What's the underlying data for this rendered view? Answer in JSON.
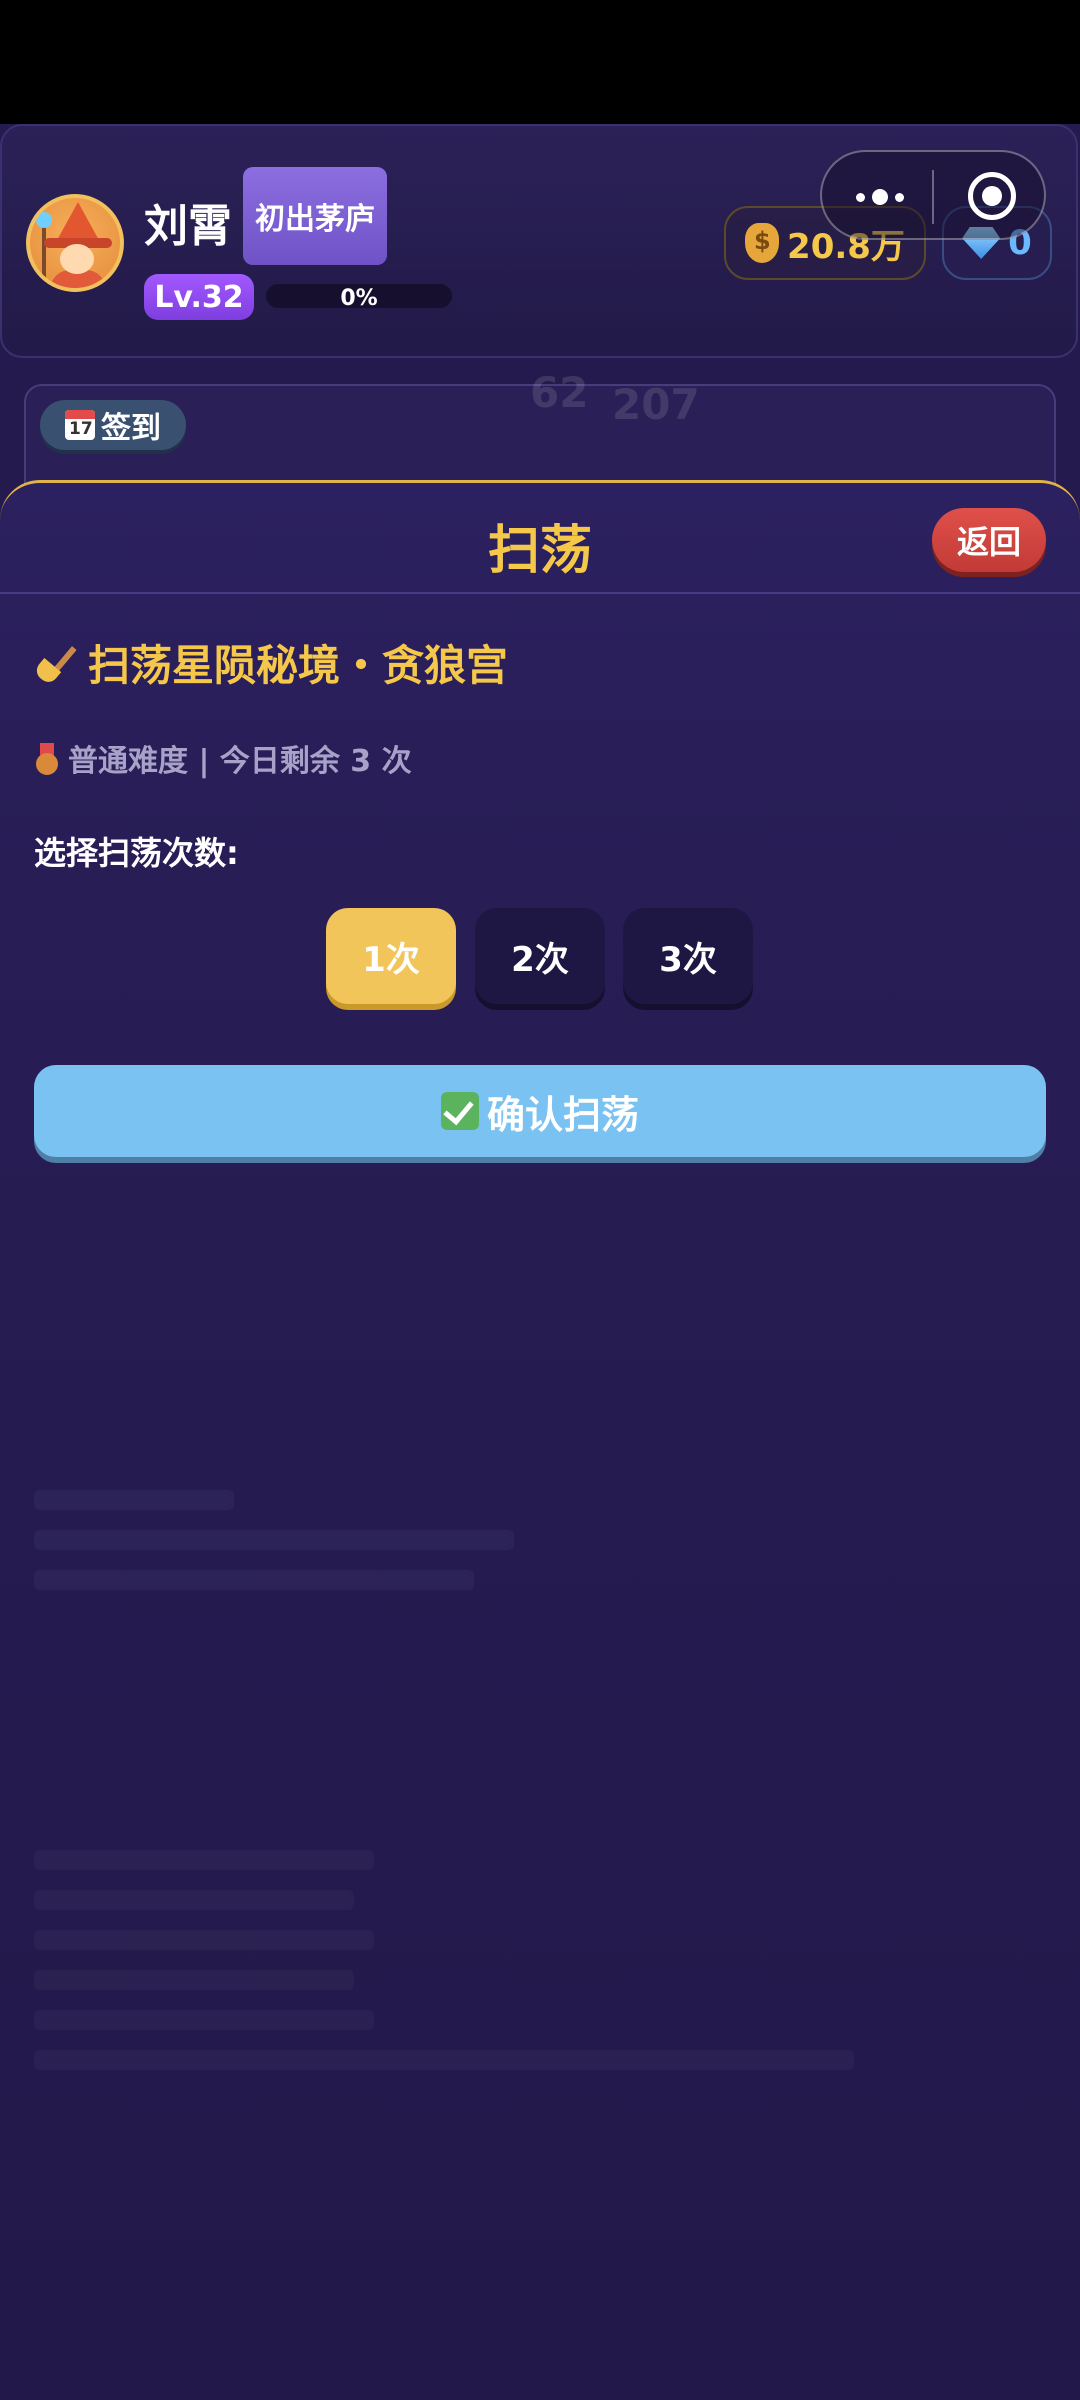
{
  "header": {
    "username": "刘霄",
    "title_badge": "初出茅庐",
    "level": "Lv.32",
    "xp_percent_text": "0%",
    "xp_progress": 0.0,
    "gold": "20.8万",
    "gems": "0",
    "icons": {
      "avatar": "wizard-avatar",
      "gold": "money-bag-icon",
      "gems": "diamond-icon"
    }
  },
  "capsule": {
    "more": "more-icon",
    "close": "target-icon"
  },
  "signin": {
    "label": "签到",
    "icon": "calendar-icon"
  },
  "background_numbers": [
    "62",
    "207"
  ],
  "modal": {
    "title": "扫荡",
    "back_label": "返回",
    "stage_title": "扫荡星陨秘境・贪狼宫",
    "difficulty_text": "普通难度 | 今日剩余 3 次",
    "choose_label": "选择扫荡次数:",
    "count_options": [
      "1次",
      "2次",
      "3次"
    ],
    "selected_option": "1次",
    "confirm_label": "确认扫荡"
  },
  "colors": {
    "accent_gold": "#f5c84a",
    "confirm_blue": "#7ac2f2",
    "back_red": "#d4443f",
    "background": "#221848"
  }
}
